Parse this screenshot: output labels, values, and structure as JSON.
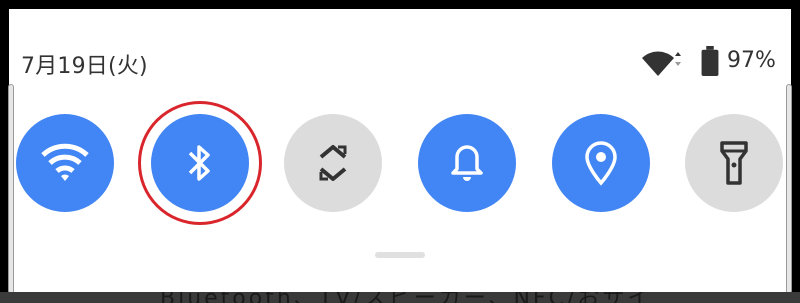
{
  "status_bar": {
    "date": "7月19日(火)",
    "battery_percent": "97%",
    "icons": [
      "wifi-signal-icon",
      "data-arrows-icon",
      "battery-icon"
    ]
  },
  "quick_settings": {
    "tiles": [
      {
        "name": "wifi",
        "icon": "wifi-icon",
        "state": "on"
      },
      {
        "name": "bluetooth",
        "icon": "bluetooth-icon",
        "state": "on",
        "highlighted": true
      },
      {
        "name": "auto-rotate",
        "icon": "rotate-icon",
        "state": "off"
      },
      {
        "name": "sound",
        "icon": "bell-icon",
        "state": "on"
      },
      {
        "name": "location",
        "icon": "location-pin-icon",
        "state": "on"
      },
      {
        "name": "flashlight",
        "icon": "flashlight-icon",
        "state": "off"
      }
    ],
    "highlight_color": "#d9262c",
    "active_color": "#4285f4",
    "inactive_color": "#dcdcdc"
  },
  "background_text": "Bluetooth、TV/スピーカー、NFC/おサイ"
}
